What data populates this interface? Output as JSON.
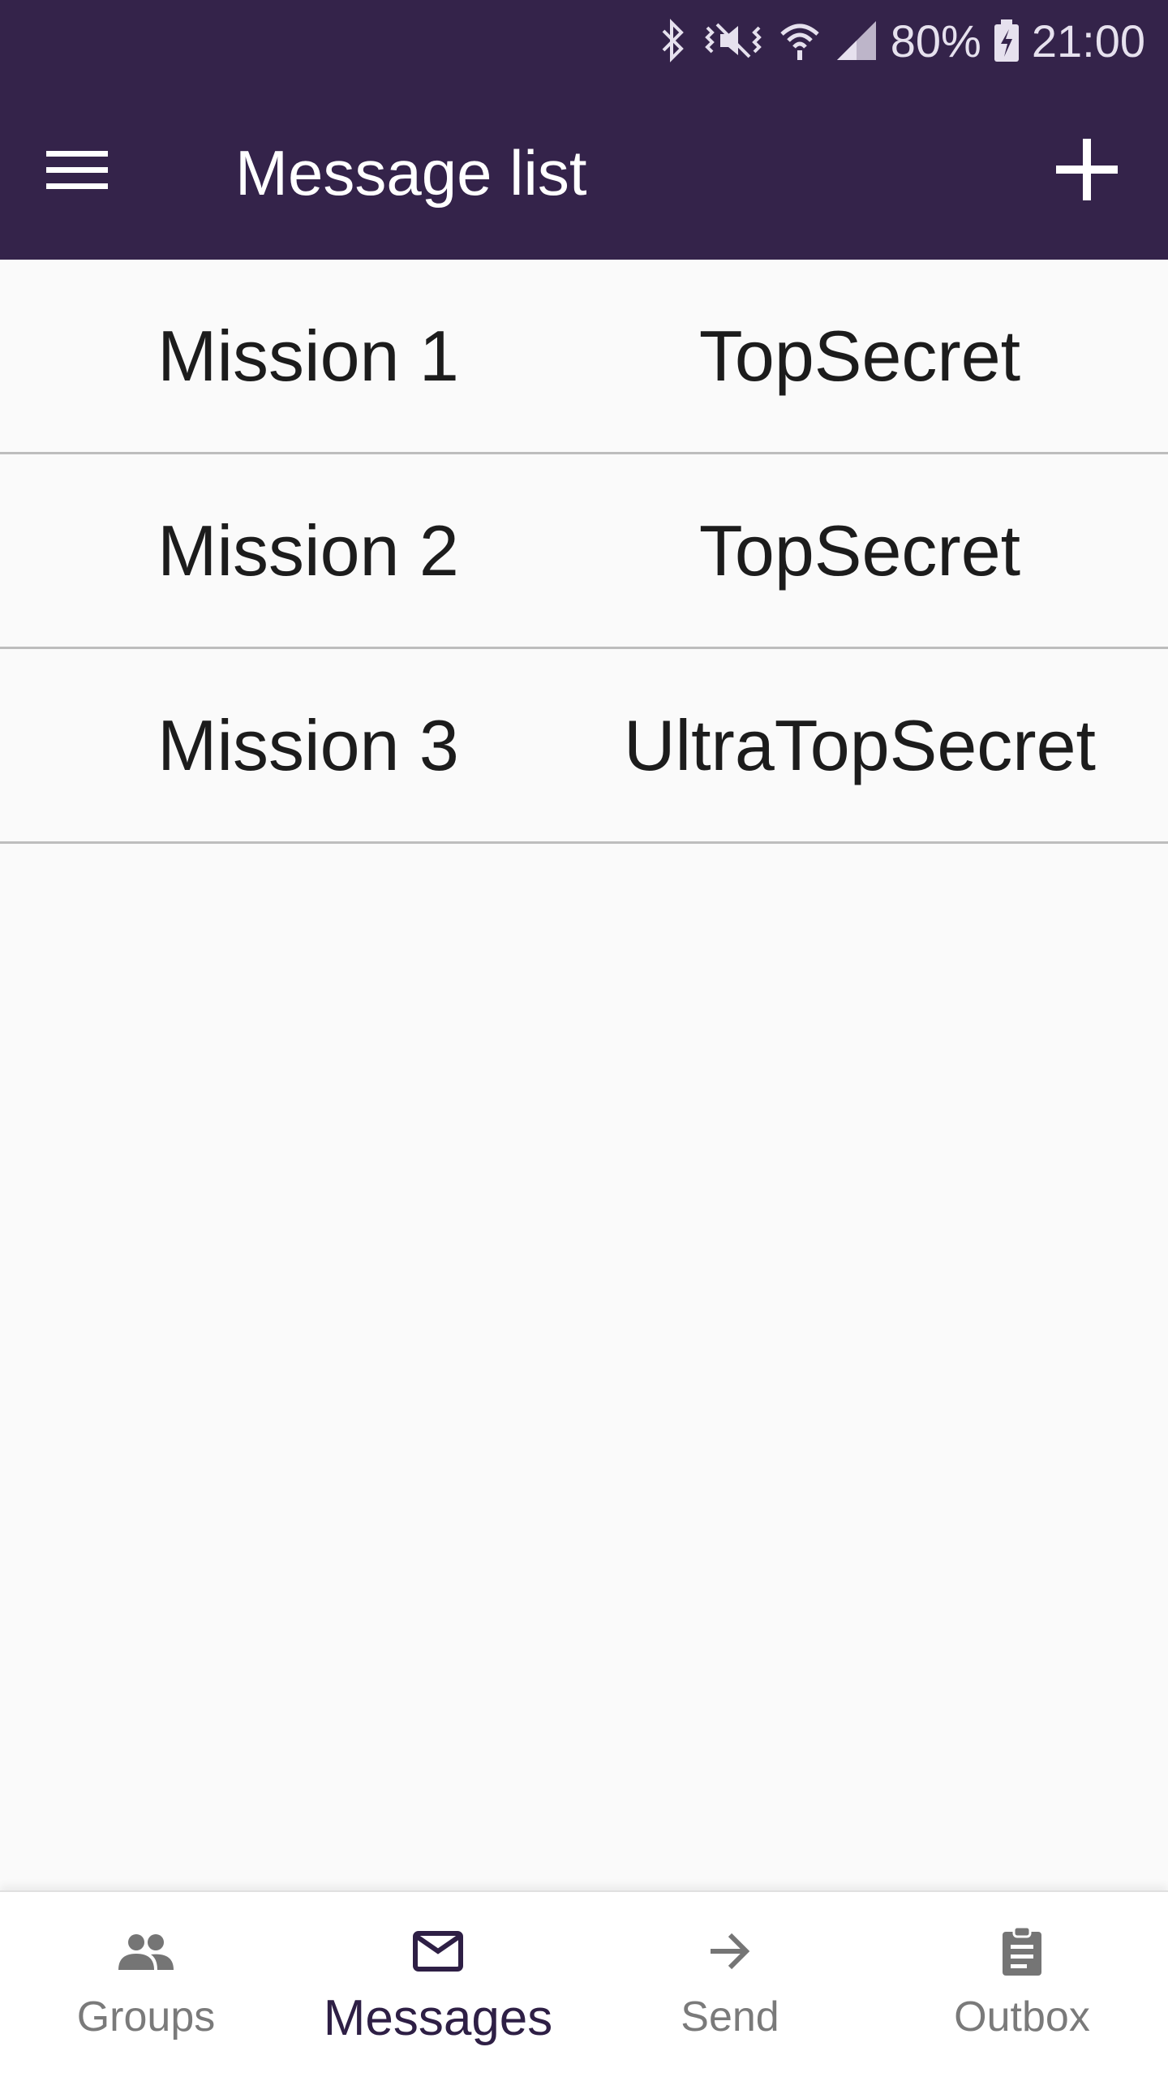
{
  "status_bar": {
    "battery": "80%",
    "time": "21:00",
    "icons": [
      "bluetooth-icon",
      "vibrate-icon",
      "wifi-icon",
      "signal-icon",
      "battery-charging-icon"
    ]
  },
  "app_bar": {
    "title": "Message list",
    "menu_icon": "hamburger-menu-icon",
    "add_icon": "plus-icon"
  },
  "messages": [
    {
      "name": "Mission 1",
      "classification": "TopSecret"
    },
    {
      "name": "Mission 2",
      "classification": "TopSecret"
    },
    {
      "name": "Mission 3",
      "classification": "UltraTopSecret"
    }
  ],
  "bottom_nav": {
    "items": [
      {
        "label": "Groups",
        "icon": "people-icon",
        "active": false
      },
      {
        "label": "Messages",
        "icon": "mail-icon",
        "active": true
      },
      {
        "label": "Send",
        "icon": "arrow-right-icon",
        "active": false
      },
      {
        "label": "Outbox",
        "icon": "clipboard-icon",
        "active": false
      }
    ]
  },
  "colors": {
    "primary": "#34234a",
    "active_nav": "#2e1f45",
    "background": "#fafafa"
  }
}
